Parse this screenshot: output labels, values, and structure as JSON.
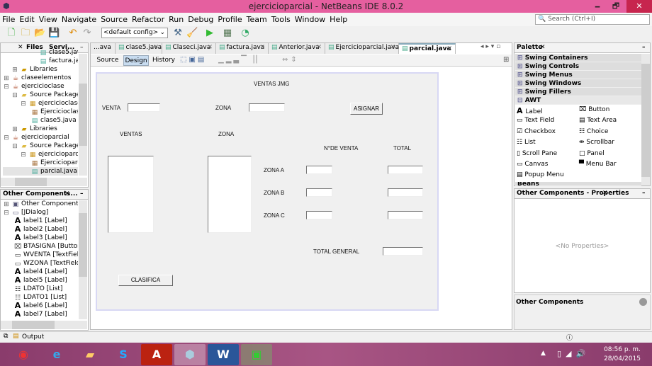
{
  "window": {
    "title": "ejercicioparcial - NetBeans IDE 8.0.2",
    "minimize": "🗕",
    "maximize": "🗗",
    "close": "✕"
  },
  "menu": [
    "File",
    "Edit",
    "View",
    "Navigate",
    "Source",
    "Refactor",
    "Run",
    "Debug",
    "Profile",
    "Team",
    "Tools",
    "Window",
    "Help"
  ],
  "search": {
    "placeholder": "Search (Ctrl+I)"
  },
  "toolbar": {
    "config": "<default config>"
  },
  "projects_panel": {
    "tabs": [
      "Files",
      "Servi..."
    ],
    "items": [
      {
        "label": "clase5.java",
        "indent": 4,
        "icon": "java-file-icon"
      },
      {
        "label": "factura.java",
        "indent": 4,
        "icon": "java-file-icon"
      },
      {
        "label": "Libraries",
        "indent": 1,
        "icon": "libraries-icon"
      },
      {
        "label": "claseelementos",
        "indent": 0,
        "icon": "project-icon"
      },
      {
        "label": "ejercicioclase",
        "indent": 0,
        "icon": "project-icon"
      },
      {
        "label": "Source Packages",
        "indent": 1,
        "icon": "folder-icon"
      },
      {
        "label": "ejercicioclase",
        "indent": 2,
        "icon": "package-icon"
      },
      {
        "label": "Ejercicioclas",
        "indent": 3,
        "icon": "java-form-icon"
      },
      {
        "label": "clase5.java",
        "indent": 3,
        "icon": "java-file-icon"
      },
      {
        "label": "Libraries",
        "indent": 1,
        "icon": "libraries-icon"
      },
      {
        "label": "ejercicioparcial",
        "indent": 0,
        "icon": "project-icon"
      },
      {
        "label": "Source Packages",
        "indent": 1,
        "icon": "folder-icon"
      },
      {
        "label": "ejercicioparcial",
        "indent": 2,
        "icon": "package-icon"
      },
      {
        "label": "Ejercicioparc",
        "indent": 3,
        "icon": "java-form-icon"
      },
      {
        "label": "parcial.java",
        "indent": 3,
        "icon": "java-file-icon"
      }
    ]
  },
  "navigator": {
    "tab": "Other Components...",
    "items": [
      {
        "label": "Other Components",
        "indent": 0,
        "icon": "components-icon"
      },
      {
        "label": "[JDialog]",
        "indent": 0,
        "icon": "dialog-icon"
      },
      {
        "label": "label1 [Label]",
        "indent": 1,
        "icon": "label-icon"
      },
      {
        "label": "label2 [Label]",
        "indent": 1,
        "icon": "label-icon"
      },
      {
        "label": "label3 [Label]",
        "indent": 1,
        "icon": "label-icon"
      },
      {
        "label": "BTASIGNA [Button]",
        "indent": 1,
        "icon": "button-icon"
      },
      {
        "label": "WVENTA [TextField]",
        "indent": 1,
        "icon": "textfield-icon"
      },
      {
        "label": "WZONA [TextField]",
        "indent": 1,
        "icon": "textfield-icon"
      },
      {
        "label": "label4 [Label]",
        "indent": 1,
        "icon": "label-icon"
      },
      {
        "label": "label5 [Label]",
        "indent": 1,
        "icon": "label-icon"
      },
      {
        "label": "LDATO [List]",
        "indent": 1,
        "icon": "list-icon"
      },
      {
        "label": "LDATO1 [List]",
        "indent": 1,
        "icon": "list-icon"
      },
      {
        "label": "label6 [Label]",
        "indent": 1,
        "icon": "label-icon"
      },
      {
        "label": "label7 [Label]",
        "indent": 1,
        "icon": "label-icon"
      }
    ]
  },
  "editor": {
    "tabs": [
      "...ava",
      "clase5.java",
      "Claseci.java",
      "factura.java",
      "Anterior.java",
      "Ejercicioparcial.java",
      "parcial.java"
    ],
    "active_tab": "parcial.java",
    "views": [
      "Source",
      "Design",
      "History"
    ],
    "active_view": "Design"
  },
  "form": {
    "title": "VENTAS JMG",
    "venta_label": "VENTA",
    "zona_label": "ZONA",
    "asignar": "ASIGNAR",
    "ventas_header": "VENTAS",
    "zona_header": "ZONA",
    "num_venta_header": "N°DE VENTA",
    "total_header": "TOTAL",
    "zona_a": "ZONA A",
    "zona_b": "ZONA B",
    "zona_c": "ZONA C",
    "total_general": "TOTAL GENERAL",
    "clasifica": "CLASIFICA"
  },
  "palette": {
    "tab": "Palette",
    "categories": [
      "Swing Containers",
      "Swing Controls",
      "Swing Menus",
      "Swing Windows",
      "Swing Fillers"
    ],
    "open": "AWT",
    "items": [
      [
        "Label",
        "Button"
      ],
      [
        "Text Field",
        "Text Area"
      ],
      [
        "Checkbox",
        "Choice"
      ],
      [
        "List",
        "Scrollbar"
      ],
      [
        "Scroll Pane",
        "Panel"
      ],
      [
        "Canvas",
        "Menu Bar"
      ],
      [
        "Popup Menu",
        ""
      ]
    ],
    "next": "Beans"
  },
  "properties": {
    "tab": "Other Components - Properties",
    "empty": "<No Properties>",
    "help_title": "Other Components"
  },
  "status": {
    "output": "Output"
  },
  "taskbar": {
    "time": "08:56 p. m.",
    "date": "28/04/2015",
    "apps": [
      "chrome",
      "internet-explorer",
      "file-explorer",
      "skype",
      "acrobat",
      "netbeans",
      "word",
      "app"
    ]
  },
  "colors": {
    "titlebar": "#e55f9f",
    "taskbar": "#8a3c6c"
  }
}
